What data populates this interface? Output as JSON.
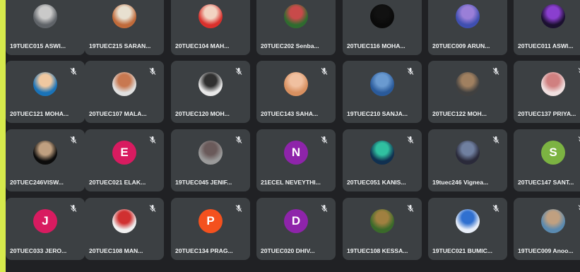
{
  "colors": {
    "frame": "#d6ea4c",
    "stage": "#202124",
    "tile": "#3c4043",
    "text": "#f1f3f4"
  },
  "participants": [
    {
      "name": "19TUEC015 ASWI...",
      "avatar": {
        "type": "photo",
        "colors": [
          "#5f6368",
          "#c9c9c9"
        ]
      },
      "mic_off_icon": false
    },
    {
      "name": "19TUEC215 SARAN...",
      "avatar": {
        "type": "photo",
        "colors": [
          "#c06a3a",
          "#e8e0d0"
        ]
      },
      "mic_off_icon": false
    },
    {
      "name": "20TUEC104 MAH...",
      "avatar": {
        "type": "photo",
        "colors": [
          "#d9302c",
          "#f2d3c2"
        ]
      },
      "mic_off_icon": false
    },
    {
      "name": "20TUEC202 Senba...",
      "avatar": {
        "type": "photo",
        "colors": [
          "#2f6b2f",
          "#c84a4a"
        ]
      },
      "mic_off_icon": false
    },
    {
      "name": "20TUEC116 MOHA...",
      "avatar": {
        "type": "photo",
        "colors": [
          "#0a0a0a",
          "#111111"
        ]
      },
      "mic_off_icon": false
    },
    {
      "name": "20TUEC009 ARUN...",
      "avatar": {
        "type": "photo",
        "colors": [
          "#3f4fb0",
          "#9a7fd8"
        ]
      },
      "mic_off_icon": false
    },
    {
      "name": "20TUEC011 ASWI...",
      "avatar": {
        "type": "photo",
        "colors": [
          "#1b1030",
          "#8a3fcf"
        ]
      },
      "mic_off_icon": false
    },
    {
      "name": "20TUEC121 MOHA...",
      "avatar": {
        "type": "photo",
        "colors": [
          "#1a73b8",
          "#f0c8a0"
        ]
      },
      "mic_off_icon": true
    },
    {
      "name": "20TUEC107 MALA...",
      "avatar": {
        "type": "photo",
        "colors": [
          "#e0e0e0",
          "#c87850"
        ]
      },
      "mic_off_icon": true
    },
    {
      "name": "20TUEC120 MOH...",
      "avatar": {
        "type": "photo",
        "colors": [
          "#e8e8e8",
          "#303030"
        ]
      },
      "mic_off_icon": true
    },
    {
      "name": "20TUEC143 SAHA...",
      "avatar": {
        "type": "photo",
        "colors": [
          "#d89060",
          "#f0c0a0"
        ]
      },
      "mic_off_icon": true
    },
    {
      "name": "19TUEC210 SANJA...",
      "avatar": {
        "type": "photo",
        "colors": [
          "#2a5a9a",
          "#6a9ad0"
        ]
      },
      "mic_off_icon": true
    },
    {
      "name": "20TUEC122 MOH...",
      "avatar": {
        "type": "photo",
        "colors": [
          "#404040",
          "#a08060"
        ]
      },
      "mic_off_icon": true
    },
    {
      "name": "20TUEC137 PRIYA...",
      "avatar": {
        "type": "photo",
        "colors": [
          "#f0e0e0",
          "#d08080"
        ]
      },
      "mic_off_icon": true
    },
    {
      "name": "20TUEC246VISW...",
      "avatar": {
        "type": "photo",
        "colors": [
          "#0c0c0c",
          "#c0a080"
        ]
      },
      "mic_off_icon": true
    },
    {
      "name": "20TUEC021 ELAK...",
      "avatar": {
        "type": "letter",
        "letter": "E",
        "bg": "#d81b60"
      },
      "mic_off_icon": true
    },
    {
      "name": "19TUEC045 JENIF...",
      "avatar": {
        "type": "photo",
        "colors": [
          "#9a9a9a",
          "#6a5a5a"
        ]
      },
      "mic_off_icon": true
    },
    {
      "name": "21ECEL NEVEYTHI...",
      "avatar": {
        "type": "letter",
        "letter": "N",
        "bg": "#8e24aa"
      },
      "mic_off_icon": true
    },
    {
      "name": "20TUEC051 KANIS...",
      "avatar": {
        "type": "photo",
        "colors": [
          "#103050",
          "#30c0a0"
        ]
      },
      "mic_off_icon": true
    },
    {
      "name": "19tuec246 Vignea...",
      "avatar": {
        "type": "photo",
        "colors": [
          "#2a2a3a",
          "#7080a0"
        ]
      },
      "mic_off_icon": true
    },
    {
      "name": "20TUEC147 SANT...",
      "avatar": {
        "type": "letter",
        "letter": "S",
        "bg": "#7cb342"
      },
      "mic_off_icon": true
    },
    {
      "name": "20TUEC033 JERO...",
      "avatar": {
        "type": "letter",
        "letter": "J",
        "bg": "#d81b60"
      },
      "mic_off_icon": true
    },
    {
      "name": "20TUEC108 MAN...",
      "avatar": {
        "type": "photo",
        "colors": [
          "#f0f0f0",
          "#d03030"
        ]
      },
      "mic_off_icon": true
    },
    {
      "name": "20TUEC134 PRAG...",
      "avatar": {
        "type": "letter",
        "letter": "P",
        "bg": "#f4511e"
      },
      "mic_off_icon": true
    },
    {
      "name": "20TUEC020 DHIV...",
      "avatar": {
        "type": "letter",
        "letter": "D",
        "bg": "#8e24aa"
      },
      "mic_off_icon": true
    },
    {
      "name": "19TUEC108 KESSA...",
      "avatar": {
        "type": "photo",
        "colors": [
          "#3a6a2a",
          "#a08040"
        ]
      },
      "mic_off_icon": true
    },
    {
      "name": "19TUEC021 BUMIC...",
      "avatar": {
        "type": "photo",
        "colors": [
          "#e8eef8",
          "#3070d0"
        ]
      },
      "mic_off_icon": true
    },
    {
      "name": "19TUEC009 Anoo...",
      "avatar": {
        "type": "photo",
        "colors": [
          "#5a8ab0",
          "#c0a080"
        ]
      },
      "mic_off_icon": true
    }
  ]
}
